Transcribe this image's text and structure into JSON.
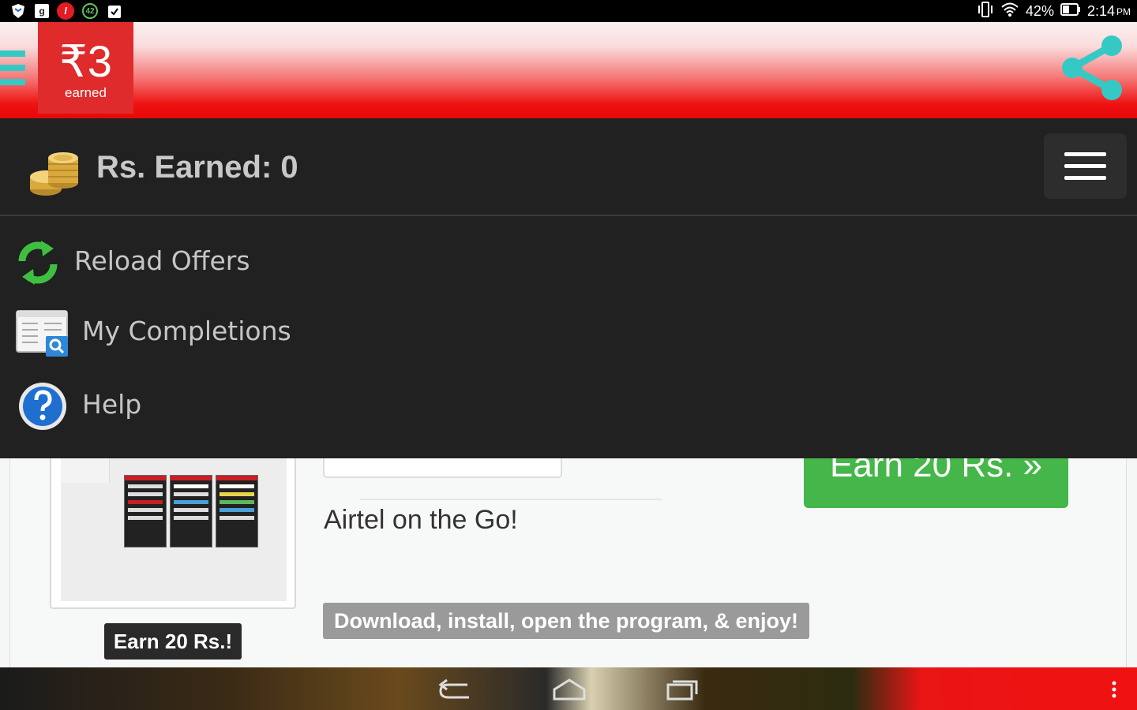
{
  "status_bar": {
    "left_icons": [
      "shield-icon",
      "google-plus-icon",
      "letter-l-icon",
      "notification-count-icon",
      "clipboard-check-icon"
    ],
    "notification_count": "42",
    "google_label": "g",
    "letter_label": "l",
    "battery": "42%",
    "time": "2:14",
    "ampm": "PM"
  },
  "app_bar": {
    "earned_amount": "₹3",
    "earned_label": "earned",
    "accent_color": "#e80808",
    "icons": [
      "hamburger-icon",
      "share-icon"
    ]
  },
  "drawer": {
    "title": "Rs. Earned: 0",
    "items": [
      {
        "label": "Reload Offers",
        "icon": "reload-icon"
      },
      {
        "label": "My Completions",
        "icon": "completions-icon"
      },
      {
        "label": "Help",
        "icon": "help-icon"
      }
    ]
  },
  "offer": {
    "brand": "airtel",
    "title": "Airtel on the Go!",
    "description": "Download, install, open the program, & enjoy!",
    "earn_tag": "Earn 20 Rs.!",
    "earn_button": "Earn 20 Rs. »",
    "button_color": "#45b649"
  },
  "nav_bar": {
    "icons": [
      "back-icon",
      "home-icon",
      "recents-icon",
      "overflow-menu-icon"
    ]
  }
}
